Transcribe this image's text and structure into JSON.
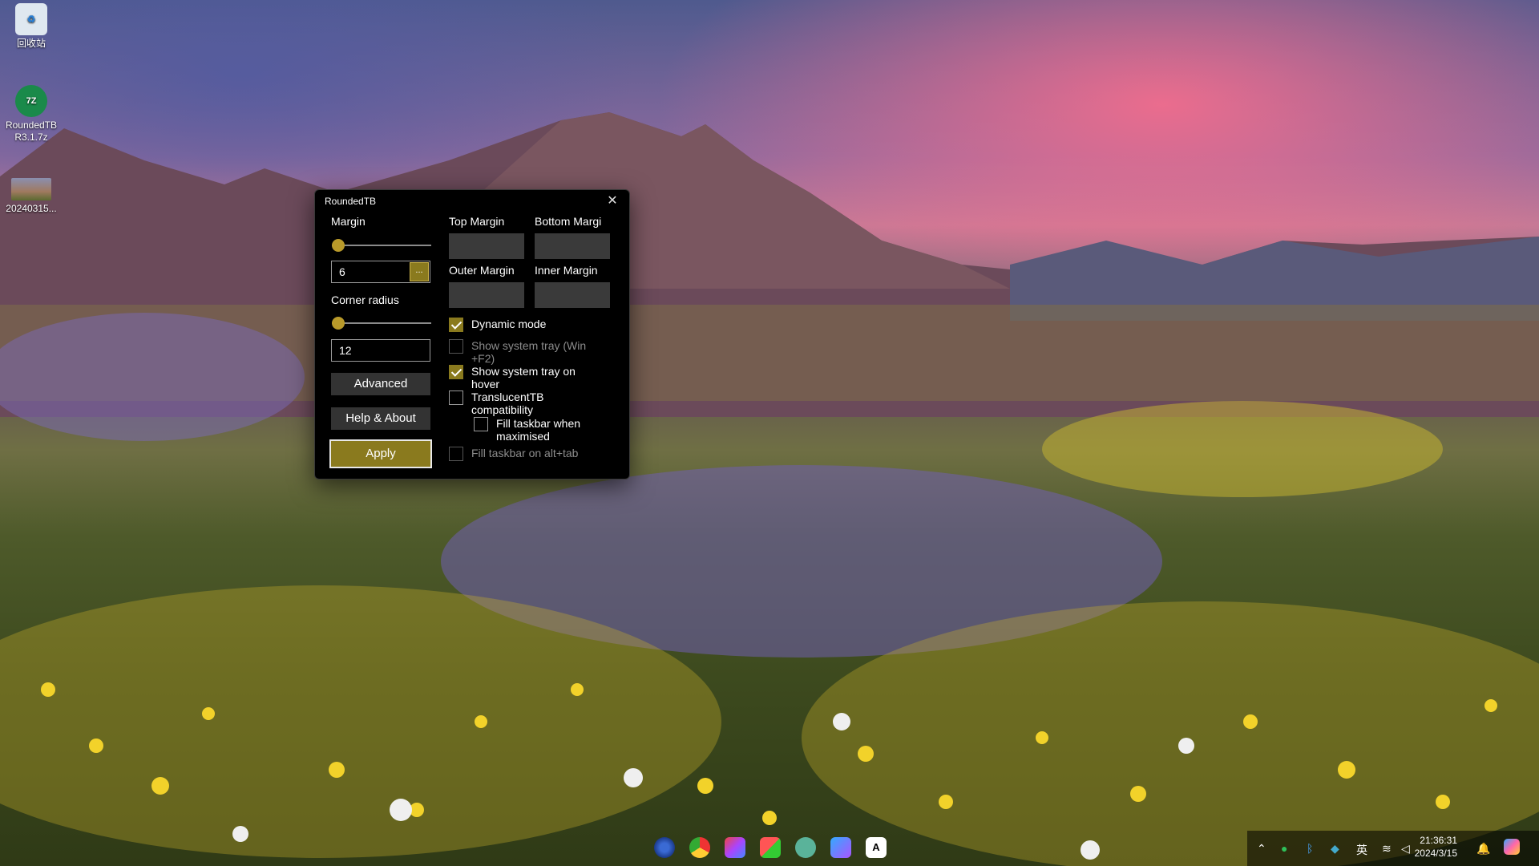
{
  "desktop": {
    "icons": [
      {
        "label": "回收站"
      },
      {
        "label": "RoundedTB\nR3.1.7z",
        "badge": "7Z"
      },
      {
        "label": "20240315..."
      }
    ]
  },
  "window": {
    "title": "RoundedTB",
    "close_glyph": "✕",
    "margin_label": "Margin",
    "margin_value": "6",
    "margin_more": "...",
    "corner_radius_label": "Corner radius",
    "corner_radius_value": "12",
    "top_margin_label": "Top Margin",
    "bottom_margin_label": "Bottom Margi",
    "outer_margin_label": "Outer Margin",
    "inner_margin_label": "Inner Margin",
    "advanced_label": "Advanced",
    "help_label": "Help & About",
    "apply_label": "Apply",
    "options": [
      {
        "label": "Dynamic mode",
        "checked": true,
        "enabled": true
      },
      {
        "label": "Show system tray (Win\n+F2)",
        "checked": false,
        "enabled": false
      },
      {
        "label": "Show system tray on\nhover",
        "checked": true,
        "enabled": true
      },
      {
        "label": "TranslucentTB\ncompatibility",
        "checked": false,
        "enabled": true
      },
      {
        "label": "Fill taskbar when\nmaximised",
        "checked": false,
        "enabled": true
      },
      {
        "label": "Fill taskbar on alt+tab",
        "checked": false,
        "enabled": false
      }
    ],
    "accent_color": "#8a7a1e"
  },
  "taskbar": {
    "apps": [
      "chrome-icon",
      "chrome-icon",
      "photos-icon",
      "store-icon",
      "chatgpt-icon",
      "copilot-icon",
      "font-icon"
    ],
    "font_app_glyph": "A",
    "tray_lang": "英",
    "clock_time": "21:36:31",
    "clock_date": "2024/3/15"
  }
}
